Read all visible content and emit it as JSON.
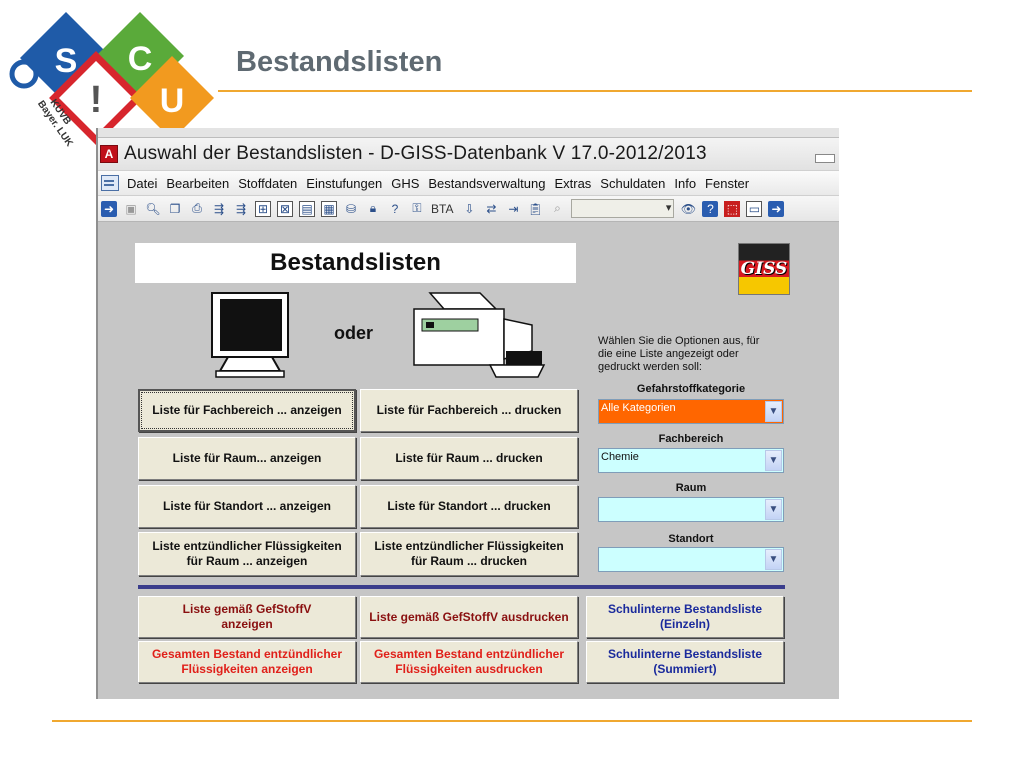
{
  "slide": {
    "title": "Bestandslisten",
    "logo": {
      "letters": [
        "S",
        "C",
        "!",
        "U"
      ],
      "caption": "KUVB Bayer. LUK",
      "colors": {
        "blue": "#1f5ba8",
        "green": "#5aaa3a",
        "red": "#d7262d",
        "orange": "#f29a1f"
      }
    },
    "accent_color": "#f0a830"
  },
  "window": {
    "title": "Auswahl der Bestandslisten - D-GISS-Datenbank V 17.0-2012/2013",
    "app_icon": "A",
    "menu": [
      "Datei",
      "Bearbeiten",
      "Stoffdaten",
      "Einstufungen",
      "GHS",
      "Bestandsverwaltung",
      "Extras",
      "Schuldaten",
      "Info",
      "Fenster"
    ],
    "toolbar_text": "BTA"
  },
  "form": {
    "title": "Bestandslisten",
    "or_label": "oder",
    "giss_logo": "GISS",
    "buttons": {
      "fach_show": "Liste für Fachbereich ... anzeigen",
      "fach_print": "Liste für Fachbereich ... drucken",
      "raum_show": "Liste für Raum... anzeigen",
      "raum_print": "Liste für Raum ... drucken",
      "stand_show": "Liste für Standort ... anzeigen",
      "stand_print": "Liste für Standort ... drucken",
      "fl_show_1": "Liste entzündlicher Flüssigkeiten",
      "fl_show_2": "für Raum ... anzeigen",
      "fl_print_1": "Liste entzündlicher Flüssigkeiten",
      "fl_print_2": "für Raum ... drucken",
      "gef_show_1": "Liste gemäß GefStoffV",
      "gef_show_2": "anzeigen",
      "gef_print": "Liste gemäß GefStoffV ausdrucken",
      "schul_einzeln_1": "Schulinterne Bestandsliste",
      "schul_einzeln_2": "(Einzeln)",
      "ges_show_1": "Gesamten Bestand entzündlicher",
      "ges_show_2": "Flüssigkeiten anzeigen",
      "ges_print_1": "Gesamten Bestand entzündlicher",
      "ges_print_2": "Flüssigkeiten ausdrucken",
      "schul_summ_1": "Schulinterne Bestandsliste",
      "schul_summ_2": "(Summiert)"
    },
    "options": {
      "info_1": "Wählen Sie die Optionen aus, für",
      "info_2": "die eine Liste angezeigt oder",
      "info_3": "gedruckt werden soll:",
      "gefahrstoff_label": "Gefahrstoffkategorie",
      "gefahrstoff_value": "Alle Kategorien",
      "fachbereich_label": "Fachbereich",
      "fachbereich_value": "Chemie",
      "raum_label": "Raum",
      "raum_value": "",
      "standort_label": "Standort",
      "standort_value": ""
    },
    "colors": {
      "highlight_combo": "#ff6600",
      "combo_bg": "#ccffff",
      "separator": "#3a3d8c"
    }
  }
}
